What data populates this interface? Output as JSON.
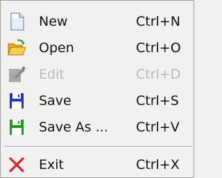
{
  "menu": {
    "items": [
      {
        "label": "New",
        "shortcut": "Ctrl+N",
        "icon": "new-document-icon",
        "enabled": true
      },
      {
        "label": "Open",
        "shortcut": "Ctrl+O",
        "icon": "open-folder-icon",
        "enabled": true
      },
      {
        "label": "Edit",
        "shortcut": "Ctrl+D",
        "icon": "edit-icon",
        "enabled": false
      },
      {
        "label": "Save",
        "shortcut": "Ctrl+S",
        "icon": "save-icon",
        "enabled": true
      },
      {
        "label": "Save As ...",
        "shortcut": "Ctrl+V",
        "icon": "save-as-icon",
        "enabled": true
      },
      {
        "label": "Exit",
        "shortcut": "Ctrl+X",
        "icon": "exit-icon",
        "enabled": true
      }
    ]
  },
  "colors": {
    "background": "#f1f1ef",
    "text": "#111111",
    "disabled_text": "#b8b8b8",
    "save_blue": "#2233cc",
    "save_as_green": "#1e9a1e",
    "exit_red": "#e02020",
    "folder_yellow": "#f2c230"
  }
}
